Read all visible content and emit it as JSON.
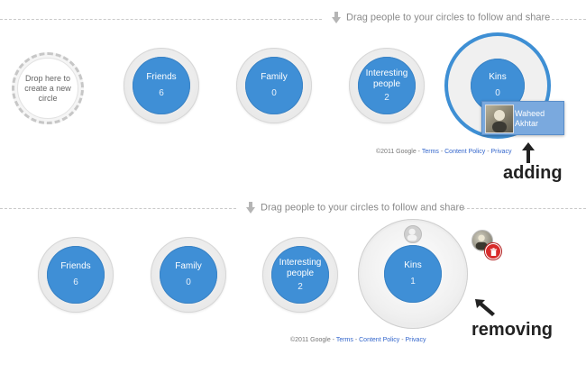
{
  "hint_text": "Drag people to your circles to follow and share",
  "drop_target": {
    "label": "Drop here to create a new circle"
  },
  "top": {
    "circles": [
      {
        "name": "Friends",
        "count": "6"
      },
      {
        "name": "Family",
        "count": "0"
      },
      {
        "name": "Interesting people",
        "count": "2"
      },
      {
        "name": "Kins",
        "count": "0"
      }
    ],
    "drag_card": {
      "name": "Waheed Akhtar"
    },
    "callout": "adding"
  },
  "bottom": {
    "circles": [
      {
        "name": "Friends",
        "count": "6"
      },
      {
        "name": "Family",
        "count": "0"
      },
      {
        "name": "Interesting people",
        "count": "2"
      },
      {
        "name": "Kins",
        "count": "1"
      }
    ],
    "callout": "removing"
  },
  "footer": {
    "copyright": "©2011 Google - ",
    "sep": " - ",
    "links": [
      "Terms",
      "Content Policy",
      "Privacy"
    ]
  },
  "colors": {
    "circle_blue": "#3f8fd6",
    "selected_ring": "#3e8fd4",
    "trash_red": "#d82b2b",
    "link": "#3366cc"
  },
  "icons": [
    "down-arrow-icon",
    "trash-icon",
    "callout-arrow-icon",
    "avatar-icon"
  ]
}
